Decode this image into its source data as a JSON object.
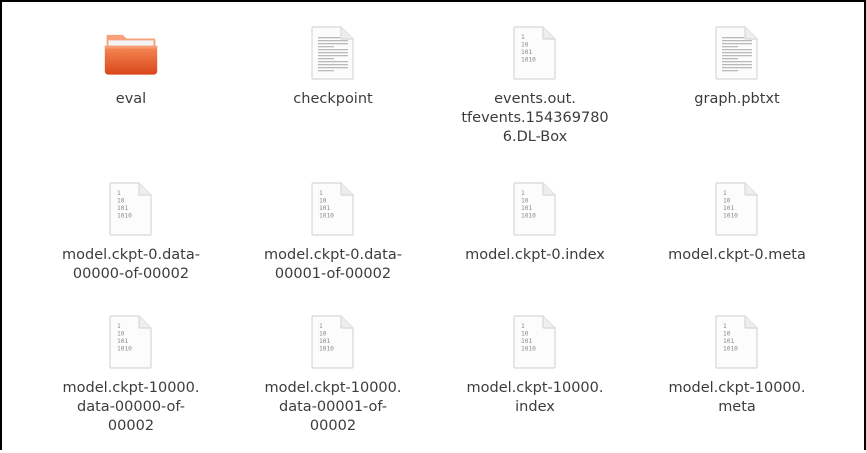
{
  "files": [
    {
      "name": "eval",
      "type": "folder",
      "icon": "folder-icon"
    },
    {
      "name": "checkpoint",
      "type": "text",
      "icon": "text-file-icon"
    },
    {
      "name": "events.out.\ntfevents.154369780\n6.DL-Box",
      "type": "binary",
      "icon": "binary-file-icon"
    },
    {
      "name": "graph.pbtxt",
      "type": "text",
      "icon": "text-file-icon"
    },
    {
      "name": "model.ckpt-0.data-\n00000-of-00002",
      "type": "binary",
      "icon": "binary-file-icon"
    },
    {
      "name": "model.ckpt-0.data-\n00001-of-00002",
      "type": "binary",
      "icon": "binary-file-icon"
    },
    {
      "name": "model.ckpt-0.index",
      "type": "binary",
      "icon": "binary-file-icon"
    },
    {
      "name": "model.ckpt-0.meta",
      "type": "binary",
      "icon": "binary-file-icon"
    },
    {
      "name": "model.ckpt-10000.\ndata-00000-of-\n00002",
      "type": "binary",
      "icon": "binary-file-icon"
    },
    {
      "name": "model.ckpt-10000.\ndata-00001-of-\n00002",
      "type": "binary",
      "icon": "binary-file-icon"
    },
    {
      "name": "model.ckpt-10000.\nindex",
      "type": "binary",
      "icon": "binary-file-icon"
    },
    {
      "name": "model.ckpt-10000.\nmeta",
      "type": "binary",
      "icon": "binary-file-icon"
    }
  ],
  "binary_glyph": [
    "1",
    "10",
    "101",
    "1010"
  ],
  "colors": {
    "folder_orange": "#e8612c",
    "folder_tab": "#f7a07a",
    "label_text": "#3c3c3c",
    "page_edge": "#d7d7d7"
  }
}
